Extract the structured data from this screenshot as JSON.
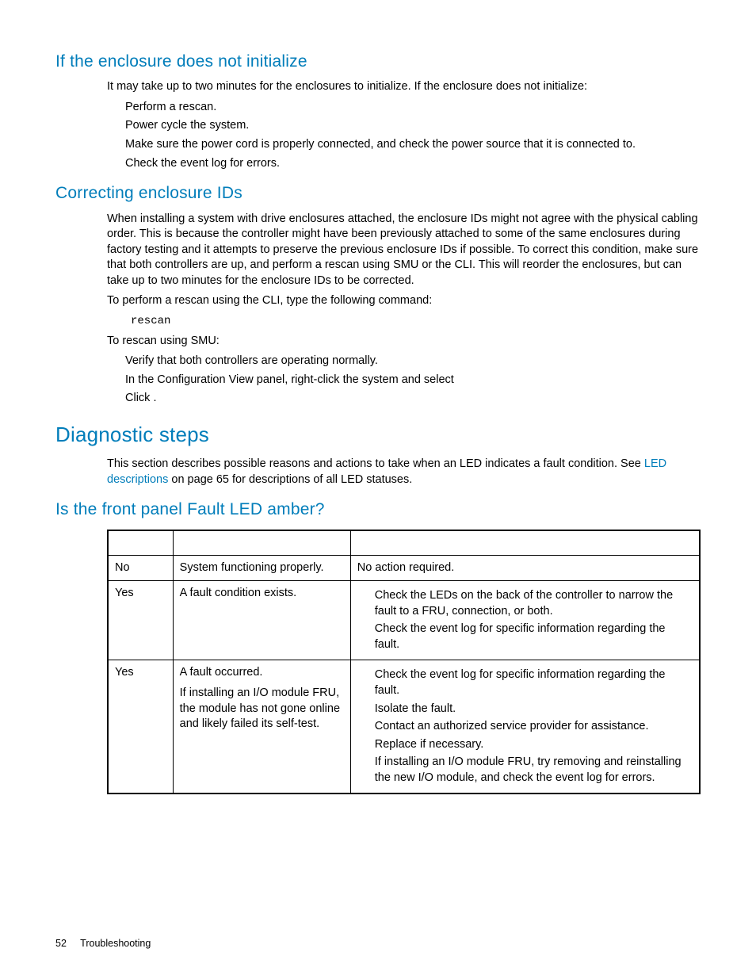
{
  "h2_enclosure_init": "If the enclosure does not initialize",
  "p_init_intro": "It may take up to two minutes for the enclosures to initialize. If the enclosure does not initialize:",
  "init_items": [
    "Perform a rescan.",
    "Power cycle the system.",
    "Make sure the power cord is properly connected, and check the power source that it is connected to.",
    "Check the event log for errors."
  ],
  "h2_correcting": "Correcting enclosure IDs",
  "p_correcting": "When installing a system with drive enclosures attached, the enclosure IDs might not agree with the physical cabling order. This is because the controller might have been previously attached to some of the same enclosures during factory testing and it attempts to preserve the previous enclosure IDs if possible. To correct this condition, make sure that both controllers are up, and perform a rescan using SMU or the CLI. This will reorder the enclosures, but can take up to two minutes for the enclosure IDs to be corrected.",
  "p_cli": "To perform a rescan using the CLI, type the following command:",
  "code_rescan": "rescan",
  "p_smu": "To rescan using SMU:",
  "smu_items": [
    "Verify that both controllers are operating normally.",
    "In the Configuration View panel, right-click the system and select",
    "Click             ."
  ],
  "h1_diag": "Diagnostic steps",
  "p_diag_1a": "This section describes possible reasons and actions to take when an LED indicates a fault condition. See ",
  "p_diag_link": "LED descriptions",
  "p_diag_1b": " on page 65 for descriptions of all LED statuses.",
  "h2_fault": "Is the front panel Fault LED amber?",
  "table": {
    "rows": [
      {
        "answer": "No",
        "reasons": [
          "System functioning properly."
        ],
        "actions": [
          "No action required."
        ],
        "actions_indent": false
      },
      {
        "answer": "Yes",
        "reasons": [
          "A fault condition exists."
        ],
        "actions": [
          "Check the LEDs on the back of the controller to narrow the fault to a FRU, connection, or both.",
          "Check the event log for specific information regarding the fault."
        ],
        "actions_indent": true
      },
      {
        "answer": "Yes",
        "reasons": [
          "A fault occurred.",
          "If installing an I/O module FRU, the module has not gone online and likely failed its self-test."
        ],
        "actions": [
          "Check the event log for specific information regarding the fault.",
          "Isolate the fault.",
          "Contact an authorized service provider for assistance.",
          "Replace if necessary.",
          "If installing an I/O module FRU, try removing and reinstalling the new I/O module, and check the event log for errors."
        ],
        "actions_indent": true
      }
    ]
  },
  "footer_page": "52",
  "footer_section": "Troubleshooting"
}
